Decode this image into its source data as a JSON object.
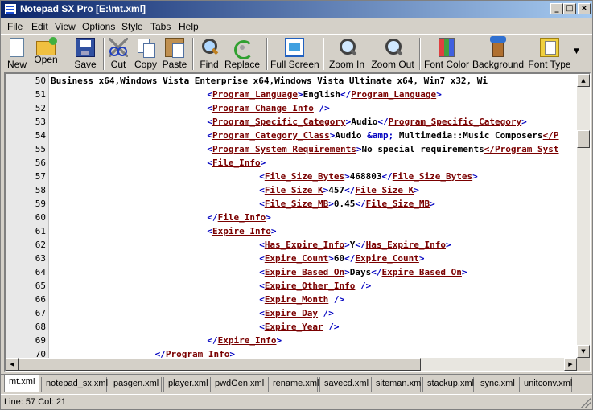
{
  "window": {
    "title": "Notepad SX Pro [E:\\mt.xml]",
    "minimize_glyph": "_",
    "maximize_glyph": "□",
    "close_glyph": "×"
  },
  "menu": [
    "File",
    "Edit",
    "View",
    "Options",
    "Style",
    "Tabs",
    "Help"
  ],
  "toolbar": {
    "buttons": [
      {
        "label": "New",
        "icon": "new-file-icon"
      },
      {
        "label": "Open",
        "icon": "open-folder-icon"
      },
      {
        "label": "Save",
        "icon": "floppy-disk-icon"
      },
      {
        "label": "Cut",
        "icon": "scissors-icon"
      },
      {
        "label": "Copy",
        "icon": "copy-pages-icon"
      },
      {
        "label": "Paste",
        "icon": "clipboard-icon"
      },
      {
        "label": "Find",
        "icon": "magnifier-icon"
      },
      {
        "label": "Replace",
        "icon": "replace-arrows-icon"
      },
      {
        "label": "Full Screen",
        "icon": "full-screen-icon"
      },
      {
        "label": "Zoom In",
        "icon": "zoom-in-icon"
      },
      {
        "label": "Zoom Out",
        "icon": "zoom-out-icon"
      },
      {
        "label": "Font Color",
        "icon": "crayons-icon"
      },
      {
        "label": "Background",
        "icon": "paint-brush-icon"
      },
      {
        "label": "Font Type",
        "icon": "font-folder-icon"
      }
    ],
    "overflow_glyph": "▼"
  },
  "editor": {
    "lines": [
      {
        "n": "50",
        "text": "Business x64,Windows Vista Enterprise x64,Windows Vista Ultimate x64, Win7 x32, Wi"
      },
      {
        "n": "51",
        "indent": "\t\t\t",
        "open": "Program_Language",
        "value": "English",
        "close": "Program_Language"
      },
      {
        "n": "52",
        "indent": "\t\t\t",
        "selfclose": "Program_Change_Info"
      },
      {
        "n": "53",
        "indent": "\t\t\t",
        "open": "Program_Specific_Category",
        "value": "Audio",
        "close": "Program_Specific_Category"
      },
      {
        "n": "54",
        "indent": "\t\t\t",
        "open": "Program_Category_Class",
        "value": "Audio ",
        "entity": "&amp;",
        "value2": " Multimedia::Music Composers",
        "tail": "</P"
      },
      {
        "n": "55",
        "indent": "\t\t\t",
        "open": "Program_System_Requirements",
        "value": "No special requirements",
        "tail": "</Program_Syst"
      },
      {
        "n": "56",
        "indent": "\t\t\t",
        "open": "File_Info"
      },
      {
        "n": "57",
        "indent": "\t\t\t\t",
        "open": "File_Size_Bytes",
        "value": "468803",
        "close": "File_Size_Bytes"
      },
      {
        "n": "58",
        "indent": "\t\t\t\t",
        "open": "File_Size_K",
        "value": "457",
        "close": "File_Size_K"
      },
      {
        "n": "59",
        "indent": "\t\t\t\t",
        "open": "File_Size_MB",
        "value": "0.45",
        "close": "File_Size_MB"
      },
      {
        "n": "60",
        "indent": "\t\t\t",
        "close": "File_Info"
      },
      {
        "n": "61",
        "indent": "\t\t\t",
        "open": "Expire_Info"
      },
      {
        "n": "62",
        "indent": "\t\t\t\t",
        "open": "Has_Expire_Info",
        "value": "Y",
        "close": "Has_Expire_Info"
      },
      {
        "n": "63",
        "indent": "\t\t\t\t",
        "open": "Expire_Count",
        "value": "60",
        "close": "Expire_Count"
      },
      {
        "n": "64",
        "indent": "\t\t\t\t",
        "open": "Expire_Based_On",
        "value": "Days",
        "close": "Expire_Based_On"
      },
      {
        "n": "65",
        "indent": "\t\t\t\t",
        "selfclose": "Expire_Other_Info"
      },
      {
        "n": "66",
        "indent": "\t\t\t\t",
        "selfclose": "Expire_Month"
      },
      {
        "n": "67",
        "indent": "\t\t\t\t",
        "selfclose": "Expire_Day"
      },
      {
        "n": "68",
        "indent": "\t\t\t\t",
        "selfclose": "Expire_Year"
      },
      {
        "n": "69",
        "indent": "\t\t\t",
        "close": "Expire_Info"
      },
      {
        "n": "70",
        "indent": "\t\t",
        "close": "Program_Info"
      }
    ]
  },
  "tabs": {
    "items": [
      "mt.xml",
      "notepad_sx.xml",
      "pasgen.xml",
      "player.xml",
      "pwdGen.xml",
      "rename.xml",
      "savecd.xml",
      "siteman.xml",
      "stackup.xml",
      "sync.xml",
      "unitconv.xml"
    ],
    "active": "mt.xml"
  },
  "status": {
    "text": "Line: 57  Col: 21"
  },
  "colors": {
    "tag": "#7a0000",
    "bracket": "#0000c0",
    "titlebar_start": "#0a246a",
    "titlebar_end": "#a6caf0"
  }
}
